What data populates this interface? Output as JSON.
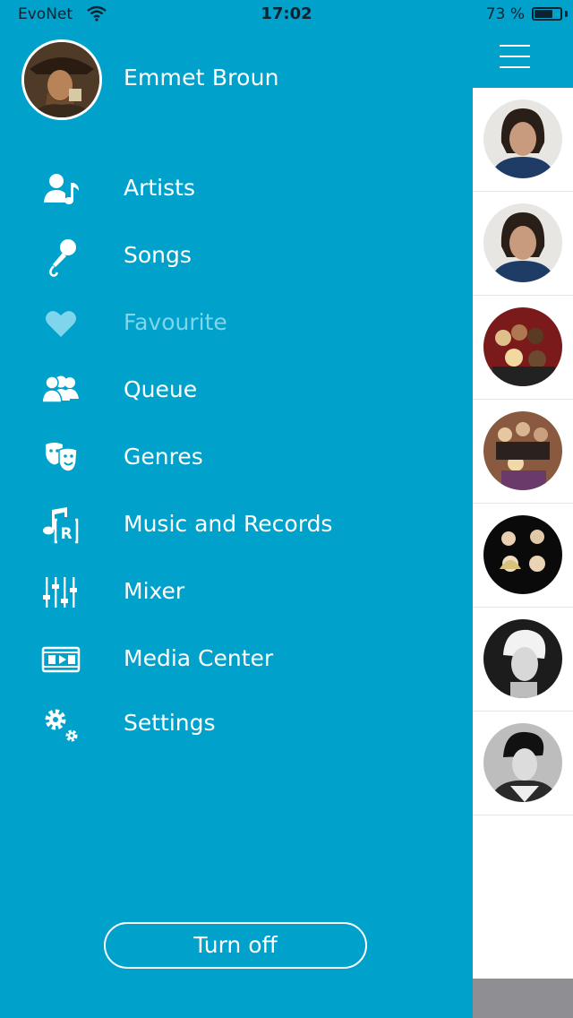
{
  "status_bar": {
    "carrier": "EvoNet",
    "time": "17:02",
    "battery_text": "73 %",
    "battery_level": 0.73
  },
  "profile": {
    "name": "Emmet Broun"
  },
  "menu": {
    "items": [
      {
        "label": "Artists",
        "icon": "artist-music-icon"
      },
      {
        "label": "Songs",
        "icon": "microphone-icon"
      },
      {
        "label": "Favourite",
        "icon": "heart-icon",
        "active": true
      },
      {
        "label": "Queue",
        "icon": "people-group-icon"
      },
      {
        "label": "Genres",
        "icon": "theater-masks-icon"
      },
      {
        "label": "Music and Records",
        "icon": "music-record-icon"
      },
      {
        "label": "Mixer",
        "icon": "mixer-sliders-icon"
      },
      {
        "label": "Media Center",
        "icon": "media-film-icon"
      },
      {
        "label": "Settings",
        "icon": "gears-icon"
      }
    ]
  },
  "turn_off": {
    "label": "Turn off"
  },
  "colors": {
    "drawer_bg": "#00a2cb",
    "active_text": "#7fd6ec",
    "content_bg": "#ffffff",
    "footer": "#8e8e93"
  }
}
